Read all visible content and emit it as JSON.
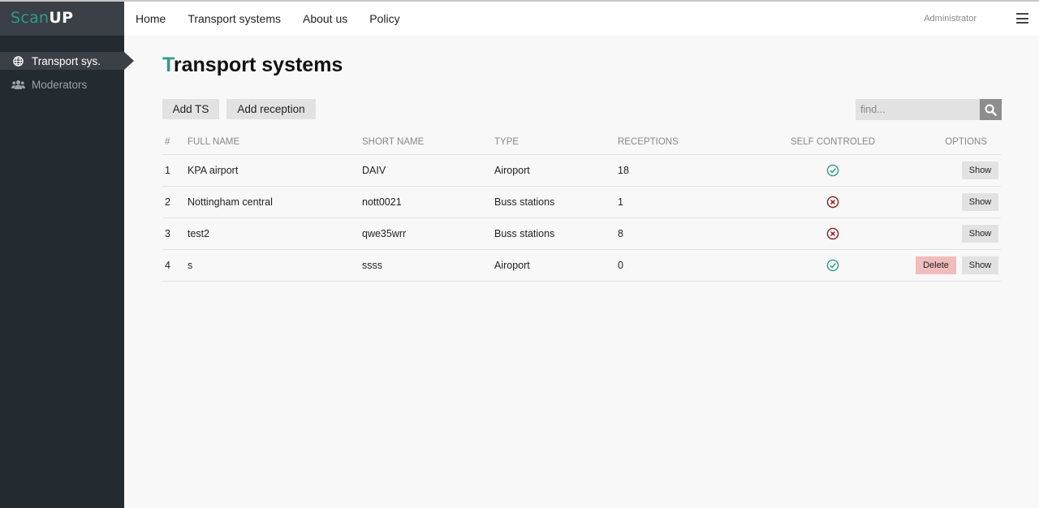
{
  "brand": {
    "part1": "Scan",
    "part2": "UP"
  },
  "sidebar": {
    "items": [
      {
        "label": "Transport sys.",
        "icon": "globe-icon",
        "active": true
      },
      {
        "label": "Moderators",
        "icon": "users-icon",
        "active": false
      }
    ]
  },
  "nav": {
    "links": [
      "Home",
      "Transport systems",
      "About us",
      "Policy"
    ],
    "user": "Administrator",
    "menu_icon": "hamburger-menu-icon"
  },
  "page": {
    "title_first": "T",
    "title_rest": "ransport systems"
  },
  "actions": {
    "add_ts": "Add TS",
    "add_reception": "Add reception"
  },
  "search": {
    "placeholder": "find...",
    "icon": "search-icon"
  },
  "table": {
    "headers": [
      "#",
      "FULL NAME",
      "SHORT NAME",
      "TYPE",
      "RECEPTIONS",
      "SELF CONTROLED",
      "OPTIONS"
    ],
    "rows": [
      {
        "num": "1",
        "full_name": "KPA airport",
        "short_name": "DAIV",
        "type": "Airoport",
        "receptions": "18",
        "self_controlled": true,
        "delete": false
      },
      {
        "num": "2",
        "full_name": "Nottingham central",
        "short_name": "nott0021",
        "type": "Buss stations",
        "receptions": "1",
        "self_controlled": false,
        "delete": false
      },
      {
        "num": "3",
        "full_name": "test2",
        "short_name": "qwe35wrr",
        "type": "Buss stations",
        "receptions": "8",
        "self_controlled": false,
        "delete": false
      },
      {
        "num": "4",
        "full_name": "s",
        "short_name": "ssss",
        "type": "Airoport",
        "receptions": "0",
        "self_controlled": true,
        "delete": true
      }
    ],
    "show_label": "Show",
    "delete_label": "Delete"
  },
  "colors": {
    "accent": "#2f9b88",
    "check": "#2f9b88",
    "cross": "#8b1a1a",
    "delete_bg": "#f1bcbc"
  }
}
